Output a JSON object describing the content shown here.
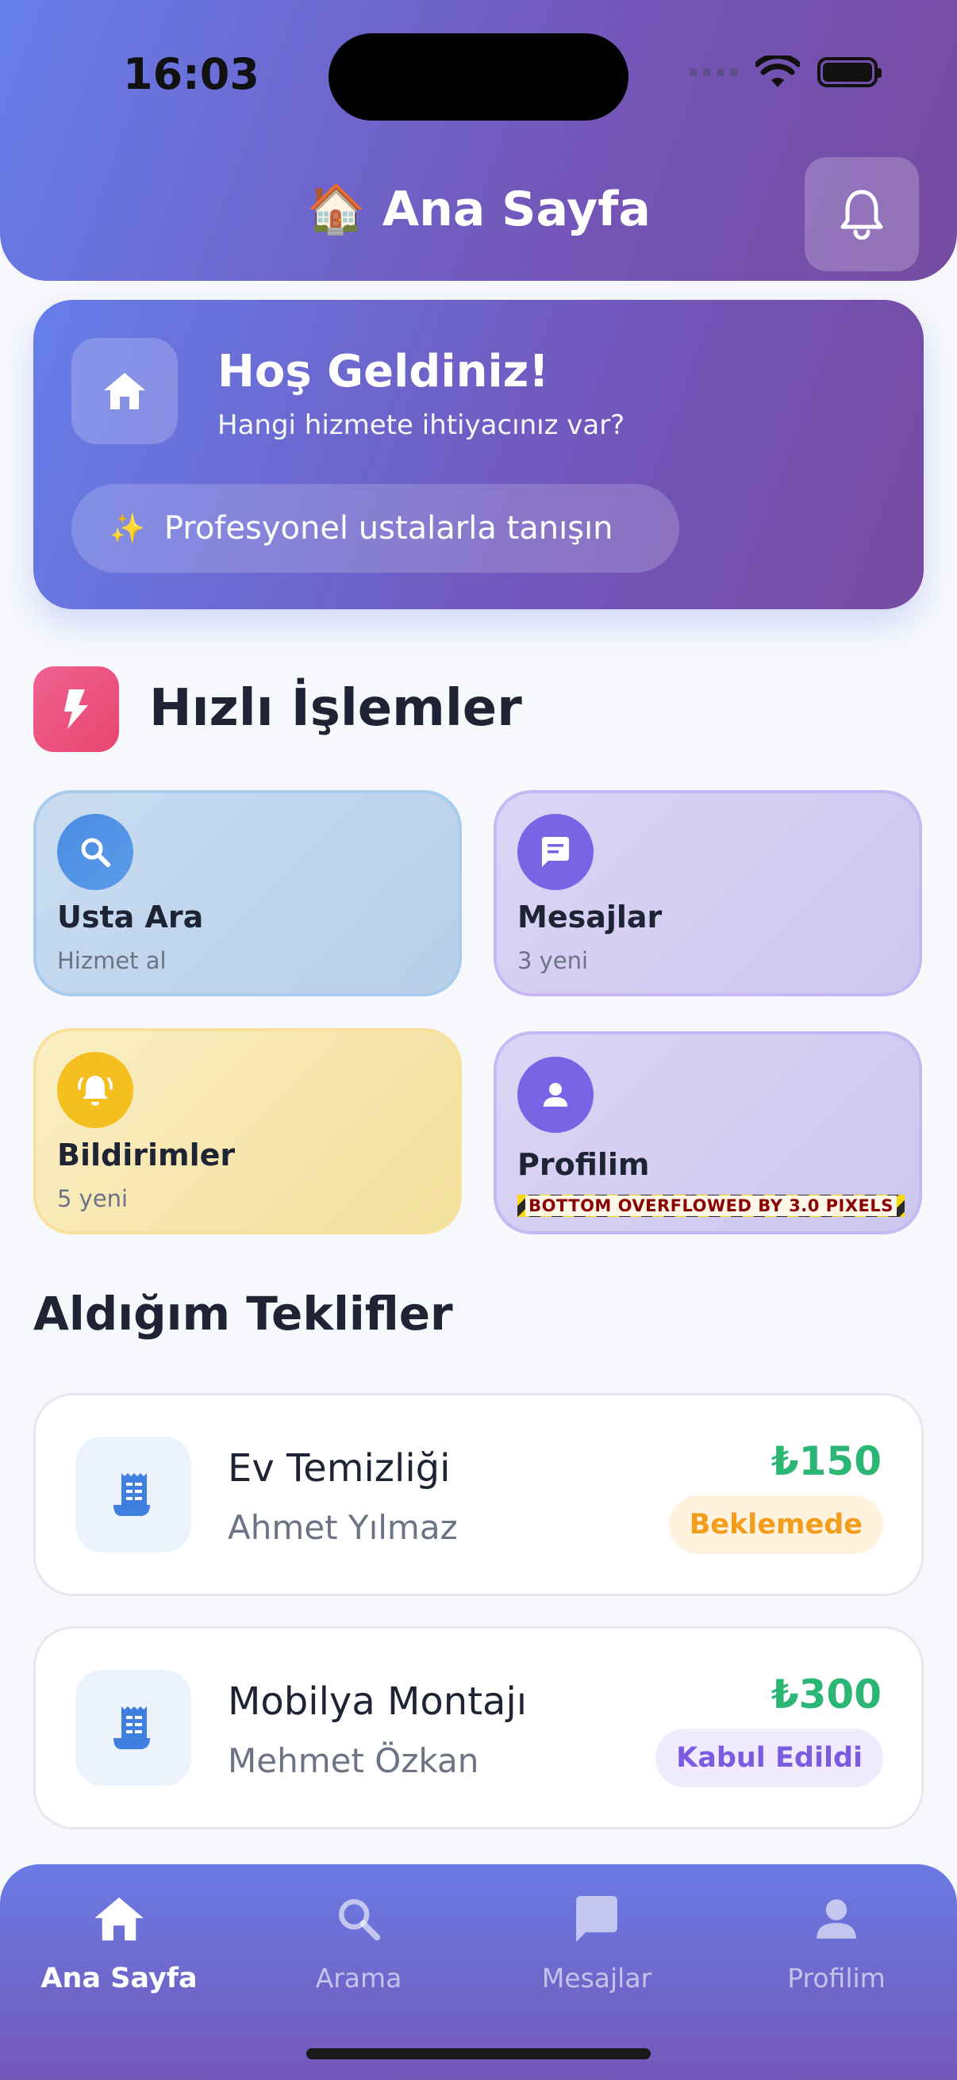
{
  "status_bar": {
    "time": "16:03"
  },
  "header": {
    "emoji": "🏠",
    "title": "Ana Sayfa"
  },
  "welcome": {
    "title": "Hoş Geldiniz!",
    "subtitle": "Hangi hizmete ihtiyacınız var?",
    "sparkle": "✨",
    "pill_text": "Profesyonel ustalarla tanışın"
  },
  "quick_actions": {
    "title": "Hızlı İşlemler",
    "items": [
      {
        "title": "Usta Ara",
        "subtitle": "Hizmet al",
        "icon": "search-icon"
      },
      {
        "title": "Mesajlar",
        "subtitle": "3 yeni",
        "icon": "chat-icon"
      },
      {
        "title": "Bildirimler",
        "subtitle": "5 yeni",
        "icon": "bell-ring-icon"
      },
      {
        "title": "Profilim",
        "subtitle": "",
        "icon": "person-icon"
      }
    ],
    "overflow_warning": "BOTTOM OVERFLOWED BY 3.0 PIXELS"
  },
  "offers": {
    "title": "Aldığım Teklifler",
    "items": [
      {
        "service": "Ev Temizliği",
        "person": "Ahmet Yılmaz",
        "price": "₺150",
        "status": "Beklemede"
      },
      {
        "service": "Mobilya Montajı",
        "person": "Mehmet Özkan",
        "price": "₺300",
        "status": "Kabul Edildi"
      }
    ]
  },
  "bottom_nav": {
    "items": [
      {
        "label": "Ana Sayfa",
        "icon": "home-icon",
        "active": true
      },
      {
        "label": "Arama",
        "icon": "search-icon",
        "active": false
      },
      {
        "label": "Mesajlar",
        "icon": "chat-icon",
        "active": false
      },
      {
        "label": "Profilim",
        "icon": "person-icon",
        "active": false
      }
    ]
  },
  "colors": {
    "primary_gradient_start": "#667eea",
    "primary_gradient_end": "#764ba2",
    "price_green": "#2bb673",
    "pending_orange": "#f29d1c",
    "accepted_purple": "#7b5be0"
  }
}
